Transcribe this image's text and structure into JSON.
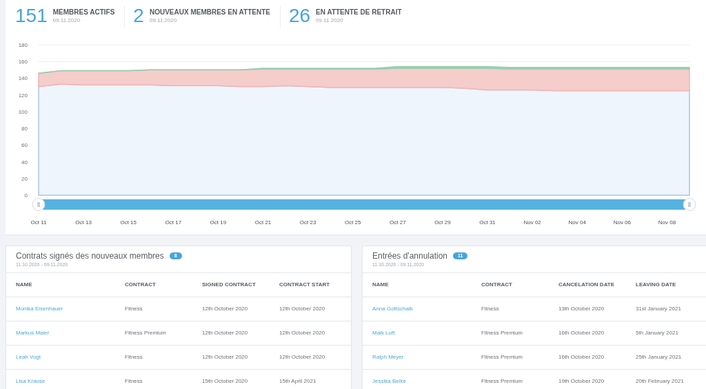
{
  "stats": [
    {
      "value": "151",
      "label": "MEMBRES ACTIFS",
      "date": "09.11.2020"
    },
    {
      "value": "2",
      "label": "NOUVEAUX MEMBRES EN ATTENTE",
      "date": "09.11.2020"
    },
    {
      "value": "26",
      "label": "EN ATTENTE DE RETRAIT",
      "date": "09.11.2020"
    }
  ],
  "chart": {
    "chart_data": {
      "type": "area",
      "stacked": true,
      "ylim": [
        0,
        180
      ],
      "yticks": [
        0,
        20,
        40,
        60,
        80,
        100,
        120,
        140,
        160,
        180
      ],
      "categories": [
        "Oct 11",
        null,
        "Oct 13",
        null,
        "Oct 15",
        null,
        "Oct 17",
        null,
        "Oct 19",
        null,
        "Oct 21",
        null,
        "Oct 23",
        null,
        "Oct 25",
        null,
        "Oct 27",
        null,
        "Oct 29",
        null,
        "Oct 31",
        null,
        "Nov 02",
        null,
        "Nov 04",
        null,
        "Nov 06",
        null,
        "Nov 08",
        null
      ],
      "series": [
        {
          "color": "#eef5fc",
          "values": [
            130,
            133,
            132,
            132,
            132,
            132,
            131,
            131,
            131,
            130,
            130,
            131,
            130,
            129,
            129,
            129,
            129,
            129,
            129,
            128,
            126,
            126,
            126,
            125,
            125,
            125,
            125,
            125,
            125,
            125
          ]
        },
        {
          "color": "#f5cdcb",
          "values": [
            16,
            16,
            17,
            17,
            17,
            18,
            19,
            19,
            19,
            20,
            21,
            20,
            21,
            22,
            22,
            22,
            23,
            23,
            23,
            24,
            26,
            25,
            25,
            26,
            26,
            26,
            26,
            26,
            26,
            26
          ]
        },
        {
          "color": "#9fd6bb",
          "values": [
            0,
            0,
            0,
            0,
            0,
            0,
            0,
            0,
            0,
            0,
            1,
            1,
            1,
            1,
            1,
            1,
            2,
            2,
            2,
            2,
            2,
            2,
            2,
            2,
            2,
            2,
            2,
            2,
            2,
            2
          ]
        }
      ]
    }
  },
  "tables": [
    {
      "title": "Contrats signés des nouveaux membres",
      "count": "8",
      "range": "11.10.2020 - 09.11.2020",
      "columns": [
        "NAME",
        "CONTRACT",
        "SIGNED CONTRACT",
        "CONTRACT START"
      ],
      "rows": [
        [
          "Monika Eisenhauer",
          "Fitness",
          "12th October 2020",
          "12th October 2020"
        ],
        [
          "Markus Maier",
          "Fitness Premium",
          "12th October 2020",
          "12th October 2020"
        ],
        [
          "Leah Vogt",
          "Fitness",
          "12th October 2020",
          "12th October 2020"
        ],
        [
          "Lisa Krause",
          "Fitness",
          "15th October 2020",
          "15th April 2021"
        ]
      ]
    },
    {
      "title": "Entrées d'annulation",
      "count": "11",
      "range": "11.10.2020 - 09.11.2020",
      "columns": [
        "NAME",
        "CONTRACT",
        "CANCELATION DATE",
        "LEAVING DATE"
      ],
      "rows": [
        [
          "Anna Gottschalk",
          "Fitness",
          "13th October 2020",
          "31st January 2021"
        ],
        [
          "Maik Luft",
          "Fitness Premium",
          "16th October 2020",
          "5th January 2021"
        ],
        [
          "Ralph Meyer",
          "Fitness Premium",
          "16th October 2020",
          "25th January 2021"
        ],
        [
          "Jessika Beike",
          "Fitness Premium",
          "19th October 2020",
          "20th February 2021"
        ]
      ]
    }
  ]
}
